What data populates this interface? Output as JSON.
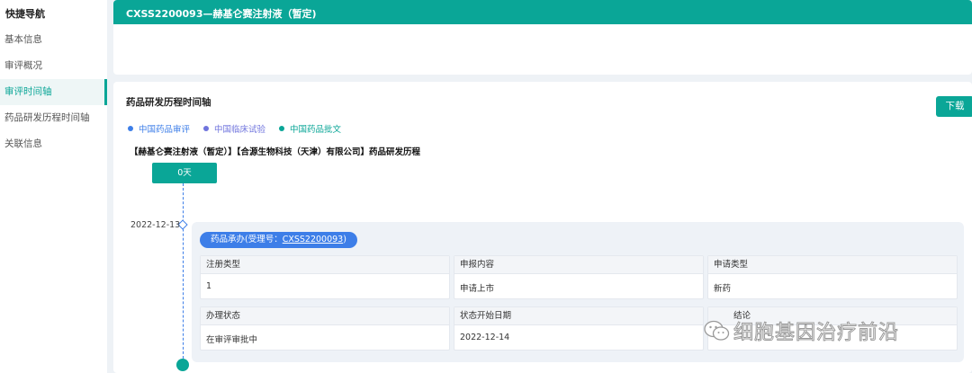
{
  "sidebar": {
    "title": "快捷导航",
    "items": [
      {
        "label": "基本信息"
      },
      {
        "label": "审评概况"
      },
      {
        "label": "审评时间轴"
      },
      {
        "label": "药品研发历程时间轴"
      },
      {
        "label": "关联信息"
      }
    ],
    "active_index": 2
  },
  "header": {
    "title": "CXSS2200093—赫基仑赛注射液（暂定)"
  },
  "main": {
    "section_title": "药品研发历程时间轴",
    "download_label": "下载",
    "legend": [
      {
        "label": "中国药品审评",
        "color": "#3d7ee8"
      },
      {
        "label": "中国临床试验",
        "color": "#6f74dd"
      },
      {
        "label": "中国药品批文",
        "color": "#0aa697"
      }
    ],
    "history_title": "【赫基仑赛注射液（暂定）】【合源生物科技（天津）有限公司】药品研发历程",
    "day_label": "0天",
    "timeline_date": "2022-12-13",
    "card": {
      "badge_prefix": "药品承办(受理号：",
      "badge_link": "CXSS2200093",
      "badge_suffix": ")",
      "fields": [
        {
          "label": "注册类型",
          "value": "1"
        },
        {
          "label": "申报内容",
          "value": "申请上市"
        },
        {
          "label": "申请类型",
          "value": "新药"
        },
        {
          "label": "办理状态",
          "value": "在审评审批中"
        },
        {
          "label": "状态开始日期",
          "value": "2022-12-14"
        },
        {
          "label": "结论",
          "value": ""
        }
      ]
    }
  },
  "watermark": {
    "text": "细胞基因治疗前沿"
  }
}
